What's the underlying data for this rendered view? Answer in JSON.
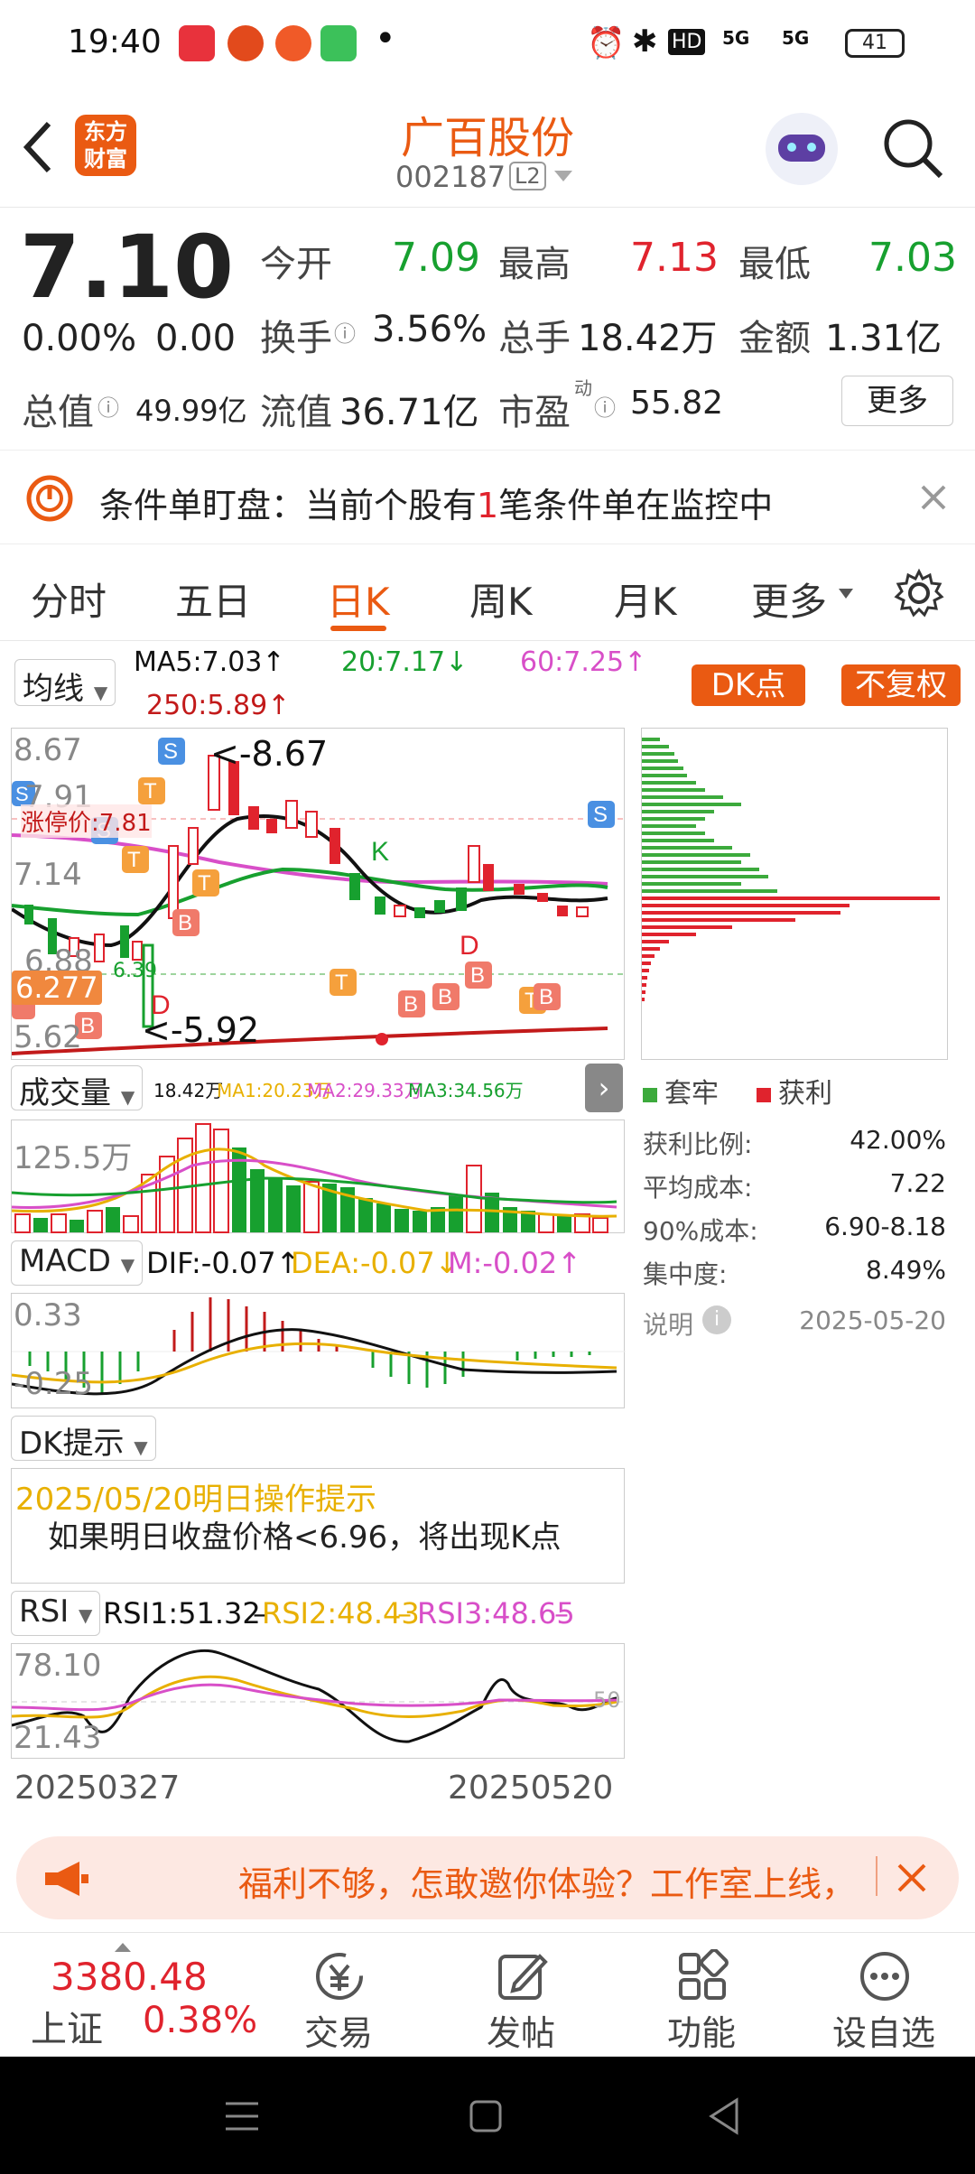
{
  "status_bar": {
    "time": "19:40",
    "dot": "•",
    "signal1": "5G",
    "signal2": "5G",
    "hd": "HD",
    "battery": "41"
  },
  "header": {
    "logo_top": "东方",
    "logo_bottom": "财富",
    "title": "广百股份",
    "code": "002187",
    "level": "L2"
  },
  "quote": {
    "price": "7.10",
    "change_pct": "0.00%",
    "change": "0.00",
    "open_label": "今开",
    "open": "7.09",
    "high_label": "最高",
    "high": "7.13",
    "low_label": "最低",
    "low": "7.03",
    "turnover_label": "换手",
    "turnover": "3.56%",
    "volume_label": "总手",
    "volume": "18.42万",
    "amount_label": "金额",
    "amount": "1.31亿",
    "mcap_label": "总值",
    "mcap": "49.99亿",
    "float_label": "流值",
    "float_mcap": "36.71亿",
    "pe_label": "市盈",
    "pe_sup": "动",
    "pe": "55.82",
    "more": "更多"
  },
  "banner": {
    "prefix": "条件单盯盘：当前个股有",
    "count": "1",
    "suffix": "笔条件单在监控中"
  },
  "tabs": [
    "分时",
    "五日",
    "日K",
    "周K",
    "月K",
    "更多"
  ],
  "kline": {
    "ma_selector": "均线",
    "ma5": "MA5:7.03",
    "ma20": "20:7.17",
    "ma60": "60:7.25",
    "ma250": "250:5.89",
    "dk_button": "DK点",
    "adjust_button": "不复权",
    "y_top": "8.67",
    "y_2": "7.91",
    "y_3": "7.14",
    "y_4": "6.88",
    "y_5": "6.277",
    "y_bottom": "5.62",
    "limit_label": "涨停价:7.81",
    "high_mark": "<-8.67",
    "low_mark": "<-5.92",
    "mid_value": "6.39"
  },
  "volume": {
    "selector": "成交量",
    "vol": "18.42万",
    "ma1": "MA1:20.23万",
    "ma2": "MA2:29.33万",
    "ma3": "MA3:34.56万",
    "y_top": "125.5万"
  },
  "macd": {
    "selector": "MACD",
    "dif": "DIF:-0.07",
    "dea": "DEA:-0.07",
    "m": "M:-0.02",
    "y_top": "0.33",
    "y_bottom": "-0.25"
  },
  "dk_tip": {
    "selector": "DK提示",
    "title": "2025/05/20明日操作提示",
    "body": "如果明日收盘价格<6.96，将出现K点"
  },
  "rsi": {
    "selector": "RSI",
    "rsi1": "RSI1:51.32",
    "rsi2": "RSI2:48.43",
    "rsi3": "RSI3:48.65",
    "y_top": "78.10",
    "y_bottom": "21.43",
    "mid": "50"
  },
  "dates": {
    "start": "20250327",
    "end": "20250520"
  },
  "chip": {
    "legend_trapped": "套牢",
    "legend_profit": "获利",
    "rows": [
      {
        "label": "获利比例:",
        "value": "42.00%"
      },
      {
        "label": "平均成本:",
        "value": "7.22"
      },
      {
        "label": "90%成本:",
        "value": "6.90-8.18"
      },
      {
        "label": "集中度:",
        "value": "8.49%"
      }
    ],
    "note_label": "说明",
    "date": "2025-05-20"
  },
  "ad": {
    "text": "福利不够，怎敢邀你体验？工作室上线，"
  },
  "bottom_nav": {
    "index_value": "3380.48",
    "index_name": "上证",
    "index_change": "0.38%",
    "trade": "交易",
    "post": "发帖",
    "features": "功能",
    "watchlist": "设自选"
  },
  "colors": {
    "up": "#e0232d",
    "down": "#17a02f",
    "accent": "#ea5a12",
    "ma60": "#d84fc8",
    "ma20": "#17a02f",
    "ma5": "#111111"
  }
}
